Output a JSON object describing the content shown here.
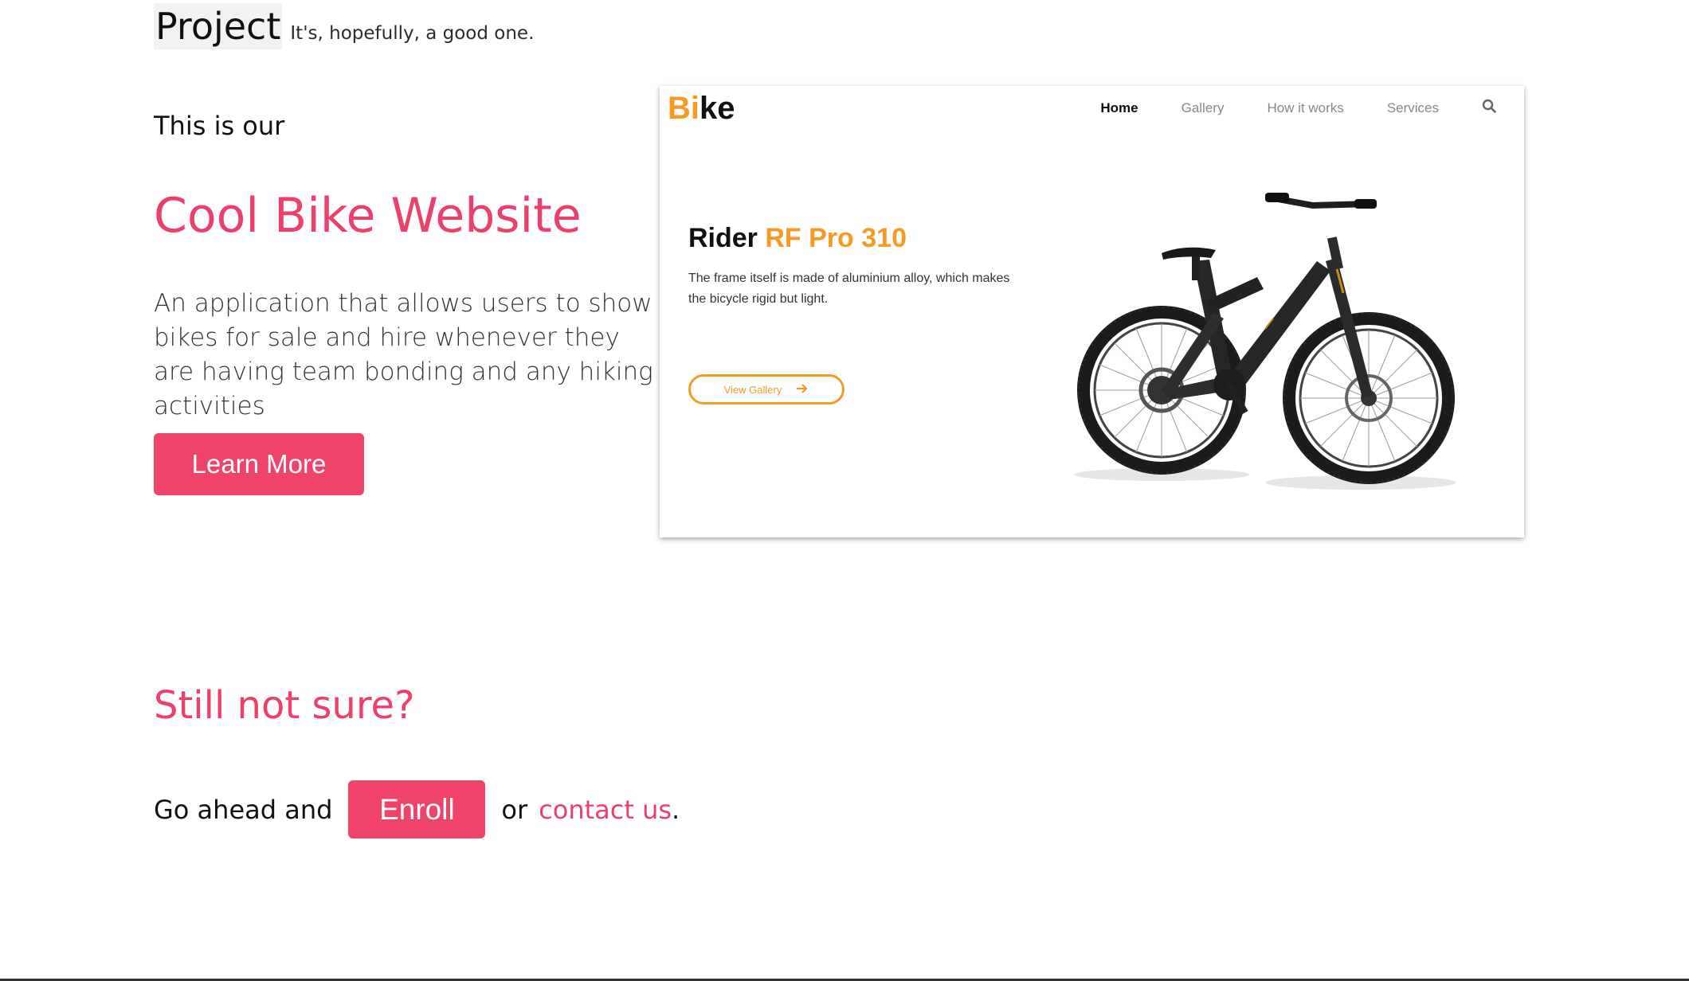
{
  "header": {
    "brand": "Project",
    "tagline": "It's, hopefully, a good one."
  },
  "hero": {
    "intro": "This is our",
    "title": "Cool Bike Website",
    "description": "An application that allows users to show bikes for sale and hire whenever they are having team bonding and any hiking activities",
    "learn_more_label": "Learn More"
  },
  "preview": {
    "logo_accent": "Bi",
    "logo_rest": "ke",
    "nav": [
      "Home",
      "Gallery",
      "How it works",
      "Services"
    ],
    "nav_active": "Home",
    "heading_dark": "Rider ",
    "heading_accent": "RF Pro 310",
    "description": "The frame itself is made of aluminium alloy, which makes the bicycle rigid but light.",
    "gallery_button_label": "View Gallery",
    "colors": {
      "accent": "#f59a23"
    }
  },
  "bottom": {
    "title": "Still not sure?",
    "prefix": "Go ahead and",
    "enroll_label": "Enroll",
    "middle": "or",
    "contact_label": "contact us",
    "suffix": "."
  },
  "colors": {
    "primary": "#ef436a"
  }
}
